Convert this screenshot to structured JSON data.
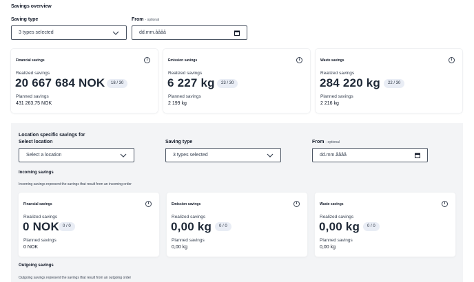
{
  "page_title": "Savings overview",
  "filters": {
    "saving_type_label": "Saving type",
    "saving_type_value": "3 types selected",
    "from_label": "From",
    "from_optional": "- optional",
    "from_placeholder": "dd.mm.åååå"
  },
  "overview_cards": [
    {
      "title": "Financial savings",
      "realized_label": "Realized savings",
      "realized_value": "20 667 684 NOK",
      "badge": "18 / 30",
      "planned_label": "Planned savings",
      "planned_value": "431 263,75 NOK"
    },
    {
      "title": "Emission savings",
      "realized_label": "Realized savings",
      "realized_value": "6 227 kg",
      "badge": "23 / 30",
      "planned_label": "Planned savings",
      "planned_value": "2 199 kg"
    },
    {
      "title": "Waste savings",
      "realized_label": "Realized savings",
      "realized_value": "284 220 kg",
      "badge": "22 / 30",
      "planned_label": "Planned savings",
      "planned_value": "2 216 kg"
    }
  ],
  "location": {
    "heading": "Location specific savings for",
    "select_location_label": "Select location",
    "select_location_placeholder": "Select a location",
    "saving_type_label": "Saving type",
    "saving_type_value": "3 types selected",
    "from_label": "From",
    "from_optional": "- optional",
    "from_placeholder": "dd.mm.åååå",
    "incoming_heading": "Incoming savings",
    "incoming_desc": "Incoming savings represent the savings that result from an incoming order",
    "incoming_cards": [
      {
        "title": "Financial savings",
        "realized_label": "Realized savings",
        "realized_value": "0 NOK",
        "badge": "0 / 0",
        "planned_label": "Planned savings",
        "planned_value": "0 NOK"
      },
      {
        "title": "Emission savings",
        "realized_label": "Realized savings",
        "realized_value": "0,00 kg",
        "badge": "0 / 0",
        "planned_label": "Planned savings",
        "planned_value": "0,00 kg"
      },
      {
        "title": "Waste savings",
        "realized_label": "Realized savings",
        "realized_value": "0,00 kg",
        "badge": "0 / 0",
        "planned_label": "Planned savings",
        "planned_value": "0,00 kg"
      }
    ],
    "outgoing_heading": "Outgoing savings",
    "outgoing_desc": "Outgoing savings represent the savings that result from an outgoing order"
  },
  "icons": {
    "info": "info-icon",
    "chevron": "chevron-down-icon",
    "calendar": "calendar-icon"
  }
}
